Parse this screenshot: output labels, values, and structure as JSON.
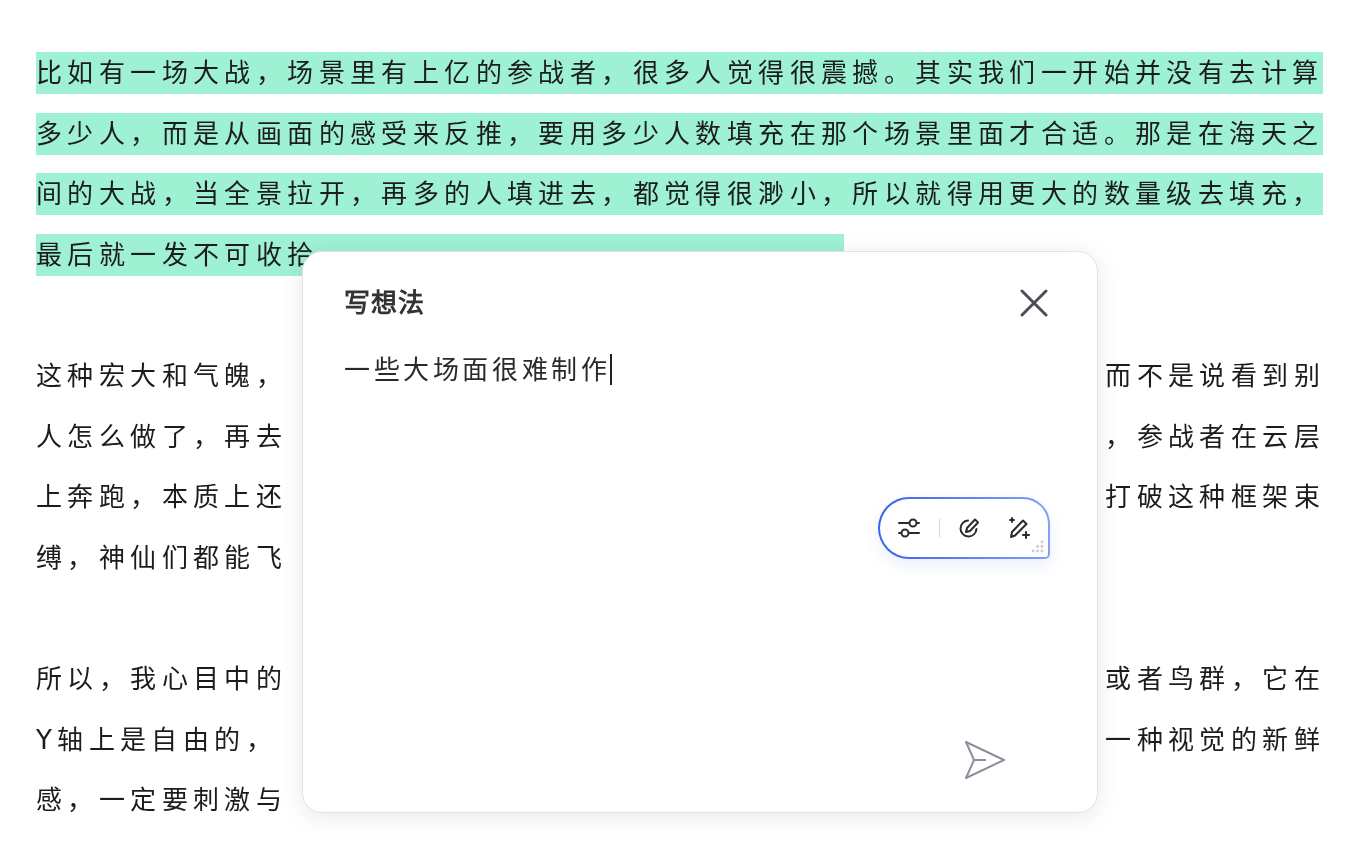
{
  "article": {
    "paragraphs": [
      {
        "highlighted": true,
        "lines": [
          {
            "start": "比如有一场大战，场景里有上亿的参战者，很多人觉得很震撼。其实我们一开始并没有去计算"
          },
          {
            "start": "多少人，而是从画面的感受来反推，要用多少人数填充在那个场景里面才合适。那是在海天之"
          },
          {
            "start": "间的大战，当全景拉开，再多的人填进去，都觉得很渺小，所以就得用更大的数量级去填充，"
          },
          {
            "start": "最后就一发不可收拾"
          }
        ]
      },
      {
        "highlighted": false,
        "lines": [
          {
            "start": "这种宏大和气魄，",
            "end": "而不是说看到别"
          },
          {
            "start": "人怎么做了，再去",
            "end": "，参战者在云层"
          },
          {
            "start": "上奔跑，本质上还",
            "end": "打破这种框架束"
          },
          {
            "start": "缚，神仙们都能飞"
          }
        ]
      },
      {
        "highlighted": false,
        "lines": [
          {
            "start": "所以，我心目中的",
            "end": "或者鸟群，它在"
          },
          {
            "start": "Y轴上是自由的，",
            "end": "一种视觉的新鲜"
          },
          {
            "start": "感，一定要刺激与"
          }
        ]
      }
    ]
  },
  "thought_popup": {
    "title": "写想法",
    "input": {
      "value": "一些大场面很难制作",
      "focused": true
    }
  }
}
